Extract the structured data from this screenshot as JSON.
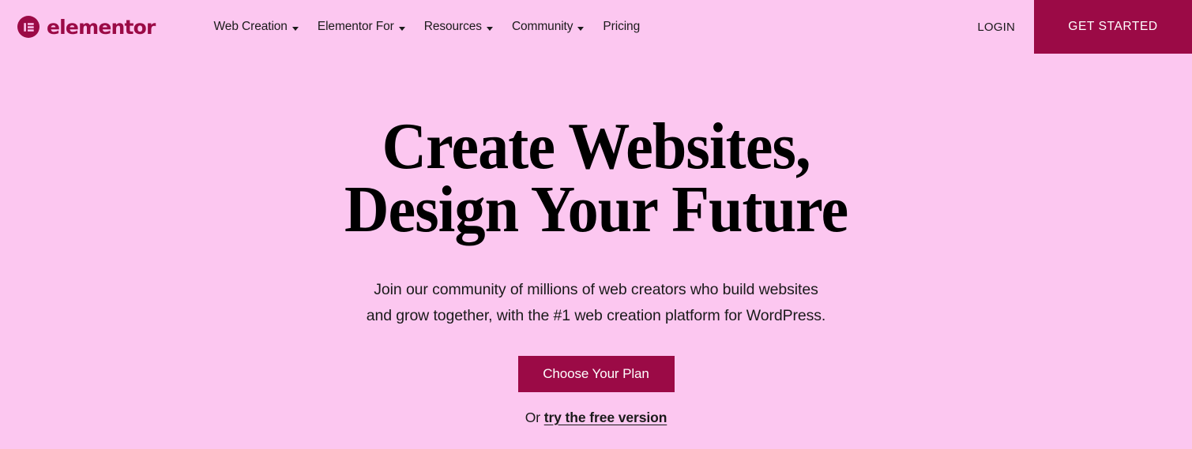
{
  "colors": {
    "background": "#fcc7f0",
    "brand": "#9b0a46",
    "text": "#1a1a1a",
    "heading": "#000000",
    "button_text": "#ffffff"
  },
  "header": {
    "logo": {
      "icon": "elementor-logo-icon",
      "wordmark": "elementor"
    },
    "nav": [
      {
        "label": "Web Creation",
        "has_dropdown": true
      },
      {
        "label": "Elementor For",
        "has_dropdown": true
      },
      {
        "label": "Resources",
        "has_dropdown": true
      },
      {
        "label": "Community",
        "has_dropdown": true
      },
      {
        "label": "Pricing",
        "has_dropdown": false
      }
    ],
    "login_label": "LOGIN",
    "get_started_label": "GET STARTED"
  },
  "hero": {
    "title_line_1": "Create Websites,",
    "title_line_2": "Design Your Future",
    "subtitle_line_1": "Join our community of millions of web creators who build websites",
    "subtitle_line_2": "and grow together, with the #1 web creation platform for WordPress.",
    "cta_label": "Choose Your Plan",
    "free_prefix": "Or ",
    "free_link_label": "try the free version"
  }
}
